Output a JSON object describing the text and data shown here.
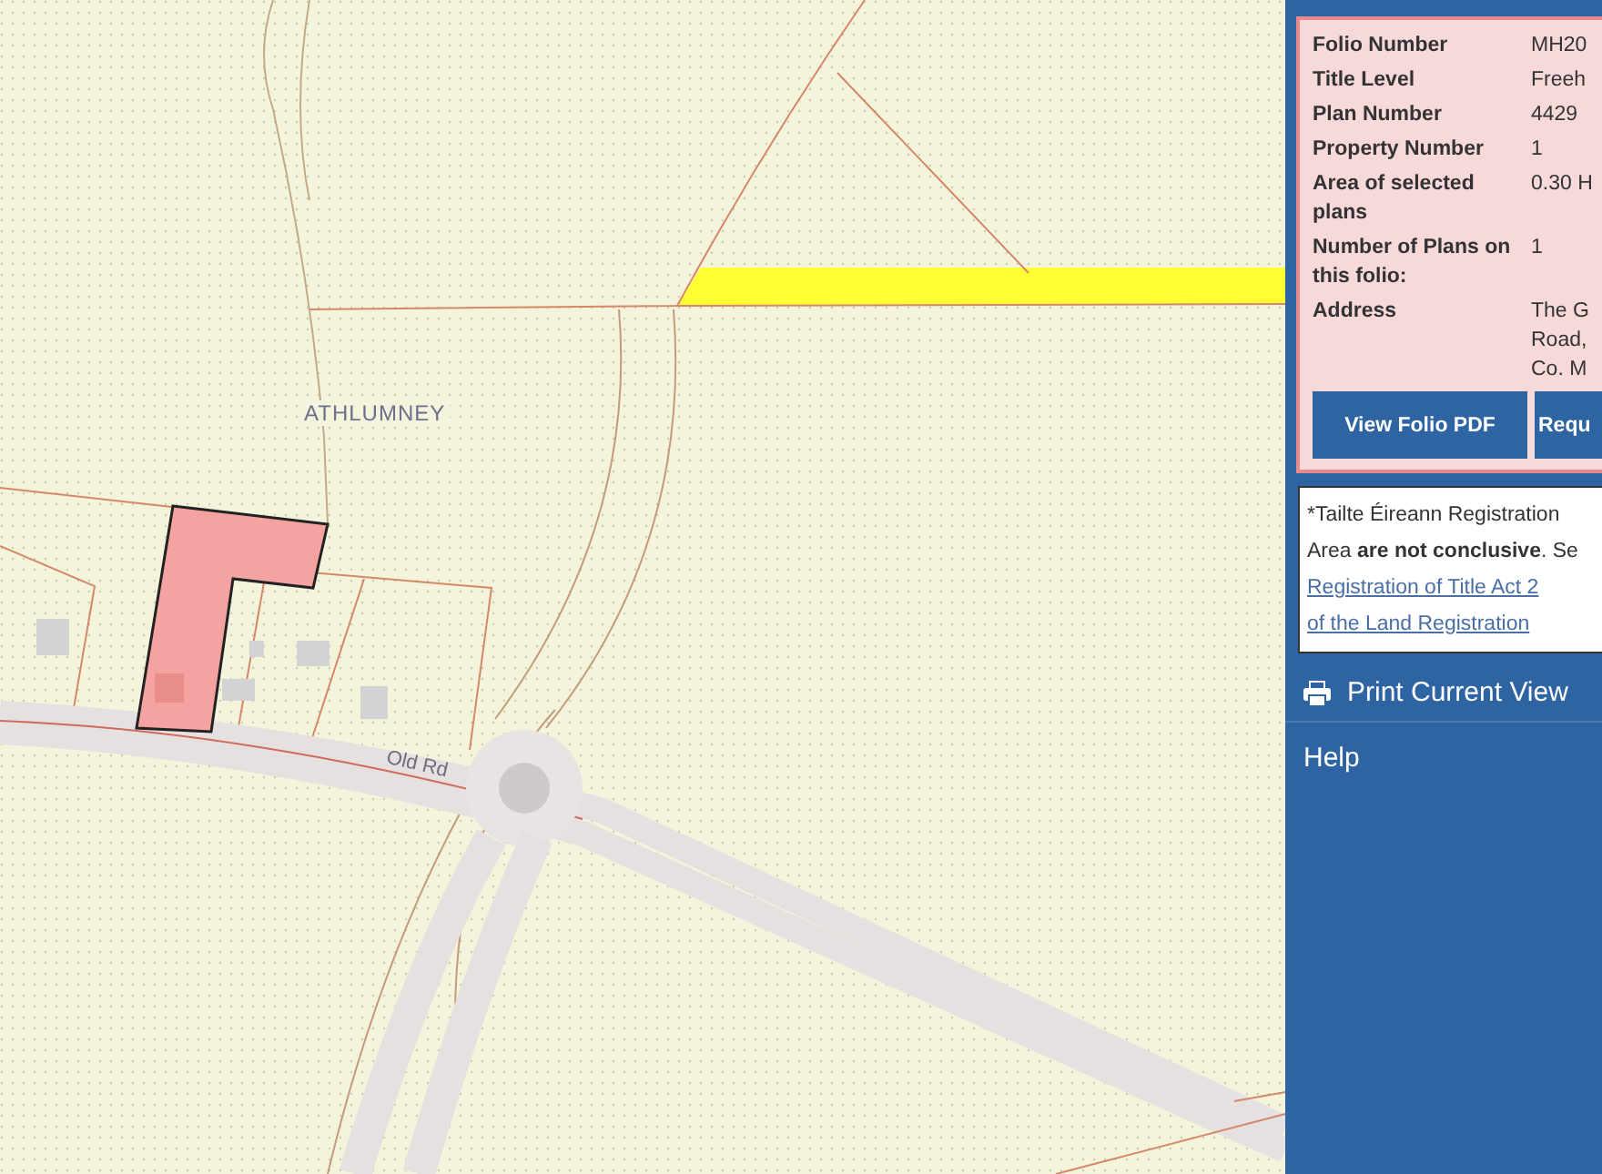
{
  "map": {
    "place_label": "ATHLUMNEY",
    "road_label": "Old Rd"
  },
  "folio": {
    "rows": [
      {
        "label": "Folio Number",
        "value": [
          "MH20"
        ]
      },
      {
        "label": "Title Level",
        "value": [
          "Freeh"
        ]
      },
      {
        "label": "Plan Number",
        "value": [
          "4429"
        ]
      },
      {
        "label": "Property Number",
        "value": [
          "1"
        ]
      },
      {
        "label": "Area of selected plans",
        "value": [
          "0.30 H"
        ]
      },
      {
        "label": "Number of Plans on this folio:",
        "value": [
          "1"
        ]
      },
      {
        "label": "Address",
        "value": [
          "The G",
          "Road,",
          "Co. M"
        ]
      }
    ],
    "buttons": [
      "View Folio PDF",
      "Requ"
    ]
  },
  "notice": {
    "lines": [
      "*Tailte Éireann Registration",
      "Area **are not conclusive**. Se"
    ],
    "links": [
      "Registration of Title Act 2",
      "of the Land Registration"
    ]
  },
  "menu": [
    {
      "kind": "print",
      "label": "Print Current View"
    },
    {
      "kind": "plain",
      "label": "Help"
    }
  ]
}
